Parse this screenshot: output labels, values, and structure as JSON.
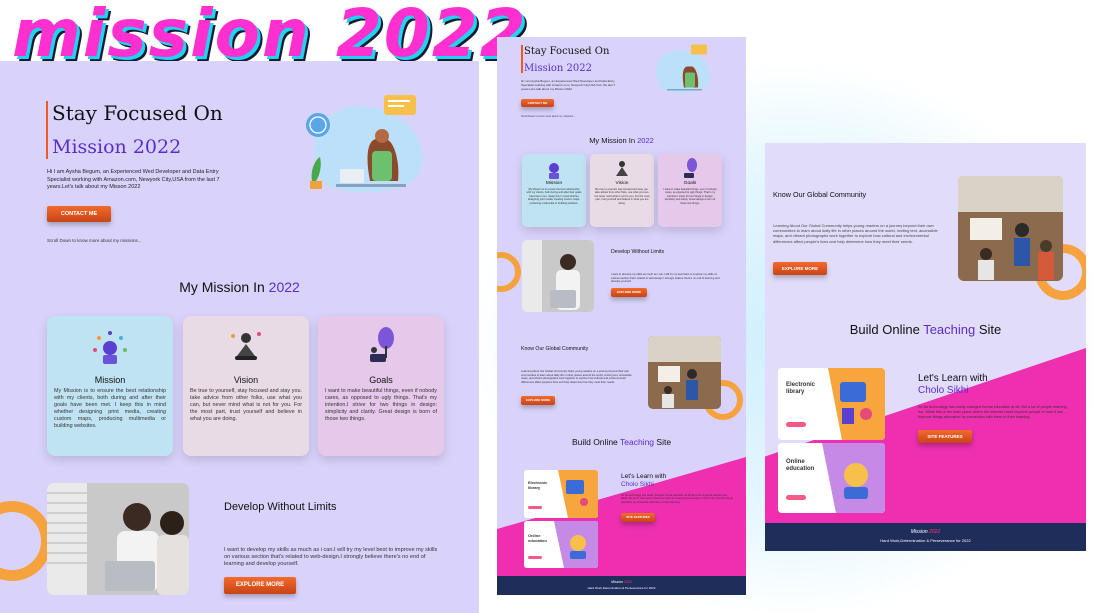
{
  "banner": {
    "text": "mission 2022"
  },
  "hero": {
    "title_line1": "Stay Focused On",
    "title_line2": "Mission 2022",
    "intro": "Hi I am Aysha Begum, an Experienced Wed Developer and Data Entry Specialist working with Amazon.com, Newyork City,USA from the last 7 years.Let's talk about my Misson 2022",
    "contact_label": "CONTACT ME",
    "scroll_hint": "Scroll Down to know more about my missions..."
  },
  "missions": {
    "title_prefix": "My Mission In",
    "title_year": "2022",
    "cards": [
      {
        "title": "Mission",
        "body": "My Mission is to ensure the best relationship with my clients, both during and after their goals have been met. I keep this in mind whether designing print media, creating custom maps, producing multimedia or building websites.",
        "bg": "#bfe3f3"
      },
      {
        "title": "Vision",
        "body": "Be true to yourself, stay focused and stay you. take advice from other folks, use what you can, but never mind what is not for you. For the most part, trust yourself and believe in what you are doing.",
        "bg": "#e8dbe6"
      },
      {
        "title": "Goals",
        "body": "I want to make beautiful things, even if nobody cares, as opposed to ugly things. That's my intention.I strive for two things in design: simplicity and clarity. Great design is born of those two things.",
        "bg": "#e6c8ea"
      }
    ]
  },
  "develop": {
    "title": "Develop Without Limits",
    "text": "I want to develop my skills as much as i can.I will try my level best to improve my skills on various section that's related to web-design.I strongly believe there's no end of learning and develop yourself.",
    "explore_label": "EXPLORE MORE"
  },
  "global": {
    "title": "Know Our Global Community",
    "text": "Learning About Our Global Community helps young readers on a journey beyond their own communities to learn about daily life in other places around the world, inviting text, accessible maps, and vibrant photographs work together to explore how cultural and environmental differences affect people's lives and help determine how they meet their needs.",
    "explore_label": "EXPLORE MORE"
  },
  "teaching": {
    "title_prefix": "Build Online",
    "title_highlight": "Teaching",
    "title_suffix": "Site",
    "card1_label": "Electronic library",
    "card2_label": "Online education",
    "learn_title": "Let's Learn with",
    "learn_sub": "Cholo Sikhi",
    "learn_text": "So far technology has vastly changed formal education at all. But a lot of people learning too, While this is the main place where the Internet could Improve people or how it can Improve things education by connection with them to their learning.",
    "features_label": "SITE FEATURES"
  },
  "footer": {
    "brand_prefix": "Mission",
    "brand_year": "2022",
    "tagline": "Hard Work,Determination & Perseverance for 2022"
  },
  "colors": {
    "accent": "#5a2ccc",
    "orange": "#ef5a24",
    "pink": "#ee2fb0",
    "navy": "#1f2d5a",
    "panel": "#d9d3fb"
  }
}
